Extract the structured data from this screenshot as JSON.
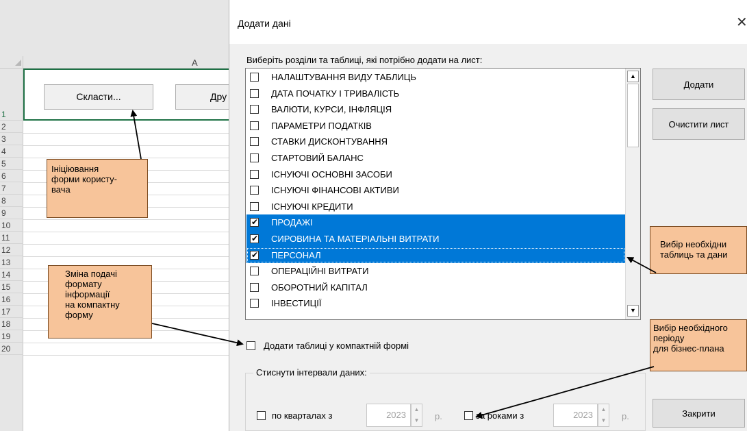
{
  "excel": {
    "column_a": "A",
    "rows": [
      "1",
      "2",
      "3",
      "4",
      "5",
      "6",
      "7",
      "8",
      "9",
      "10",
      "11",
      "12",
      "13",
      "14",
      "15",
      "16",
      "17",
      "18",
      "19",
      "20"
    ],
    "button_combine": "Скласти...",
    "button_other": "Дру"
  },
  "dialog": {
    "title": "Додати дані",
    "close_glyph": "✕",
    "prompt": "Виберіть розділи та таблиці, які потрібно додати на лист:",
    "items": [
      {
        "label": "НАЛАШТУВАННЯ ВИДУ ТАБЛИЦЬ",
        "checked": false
      },
      {
        "label": "ДАТА ПОЧАТКУ І ТРИВАЛІСТЬ",
        "checked": false
      },
      {
        "label": "ВАЛЮТИ, КУРСИ, ІНФЛЯЦІЯ",
        "checked": false
      },
      {
        "label": "ПАРАМЕТРИ ПОДАТКІВ",
        "checked": false
      },
      {
        "label": "СТАВКИ ДИСКОНТУВАННЯ",
        "checked": false
      },
      {
        "label": "СТАРТОВИЙ БАЛАНС",
        "checked": false
      },
      {
        "label": "ІСНУЮЧІ ОСНОВНІ ЗАСОБИ",
        "checked": false
      },
      {
        "label": "ІСНУЮЧІ ФІНАНСОВІ АКТИВИ",
        "checked": false
      },
      {
        "label": "ІСНУЮЧІ КРЕДИТИ",
        "checked": false
      },
      {
        "label": "ПРОДАЖІ",
        "checked": true
      },
      {
        "label": "СИРОВИНА ТА МАТЕРІАЛЬНІ ВИТРАТИ",
        "checked": true
      },
      {
        "label": "ПЕРСОНАЛ",
        "checked": true
      },
      {
        "label": "ОПЕРАЦІЙНІ ВИТРАТИ",
        "checked": false
      },
      {
        "label": "ОБОРОТНИЙ КАПІТАЛ",
        "checked": false
      },
      {
        "label": "ІНВЕСТИЦІЇ",
        "checked": false
      }
    ],
    "check_glyph": "✔",
    "scroll_up": "▲",
    "scroll_down": "▼",
    "button_add": "Додати",
    "button_clear": "Очистити лист",
    "compact_label": "Додати таблиці у компактній формі",
    "compress_title": "Стиснути інтервали даних:",
    "quarter_label": "по кварталах з",
    "quarter_year": "2023",
    "year_label": "за роками з",
    "year_year": "2023",
    "unit": "р.",
    "spin_glyph": "▲\n▼",
    "button_close": "Закрити"
  },
  "callouts": {
    "init": "Ініціювання\nформи користу-\nвача",
    "compact": "Зміна подачі\nформату\nінформації\nна компактну\nформу",
    "tables": "Вибір необхідни\nтаблиць та дани",
    "period": "Вибір необхідного\nперіоду\nдля бізнес-плана"
  },
  "colors": {
    "selection": "#0078d7",
    "callout_fill": "#f7c49a",
    "excel_green": "#1e7145"
  }
}
